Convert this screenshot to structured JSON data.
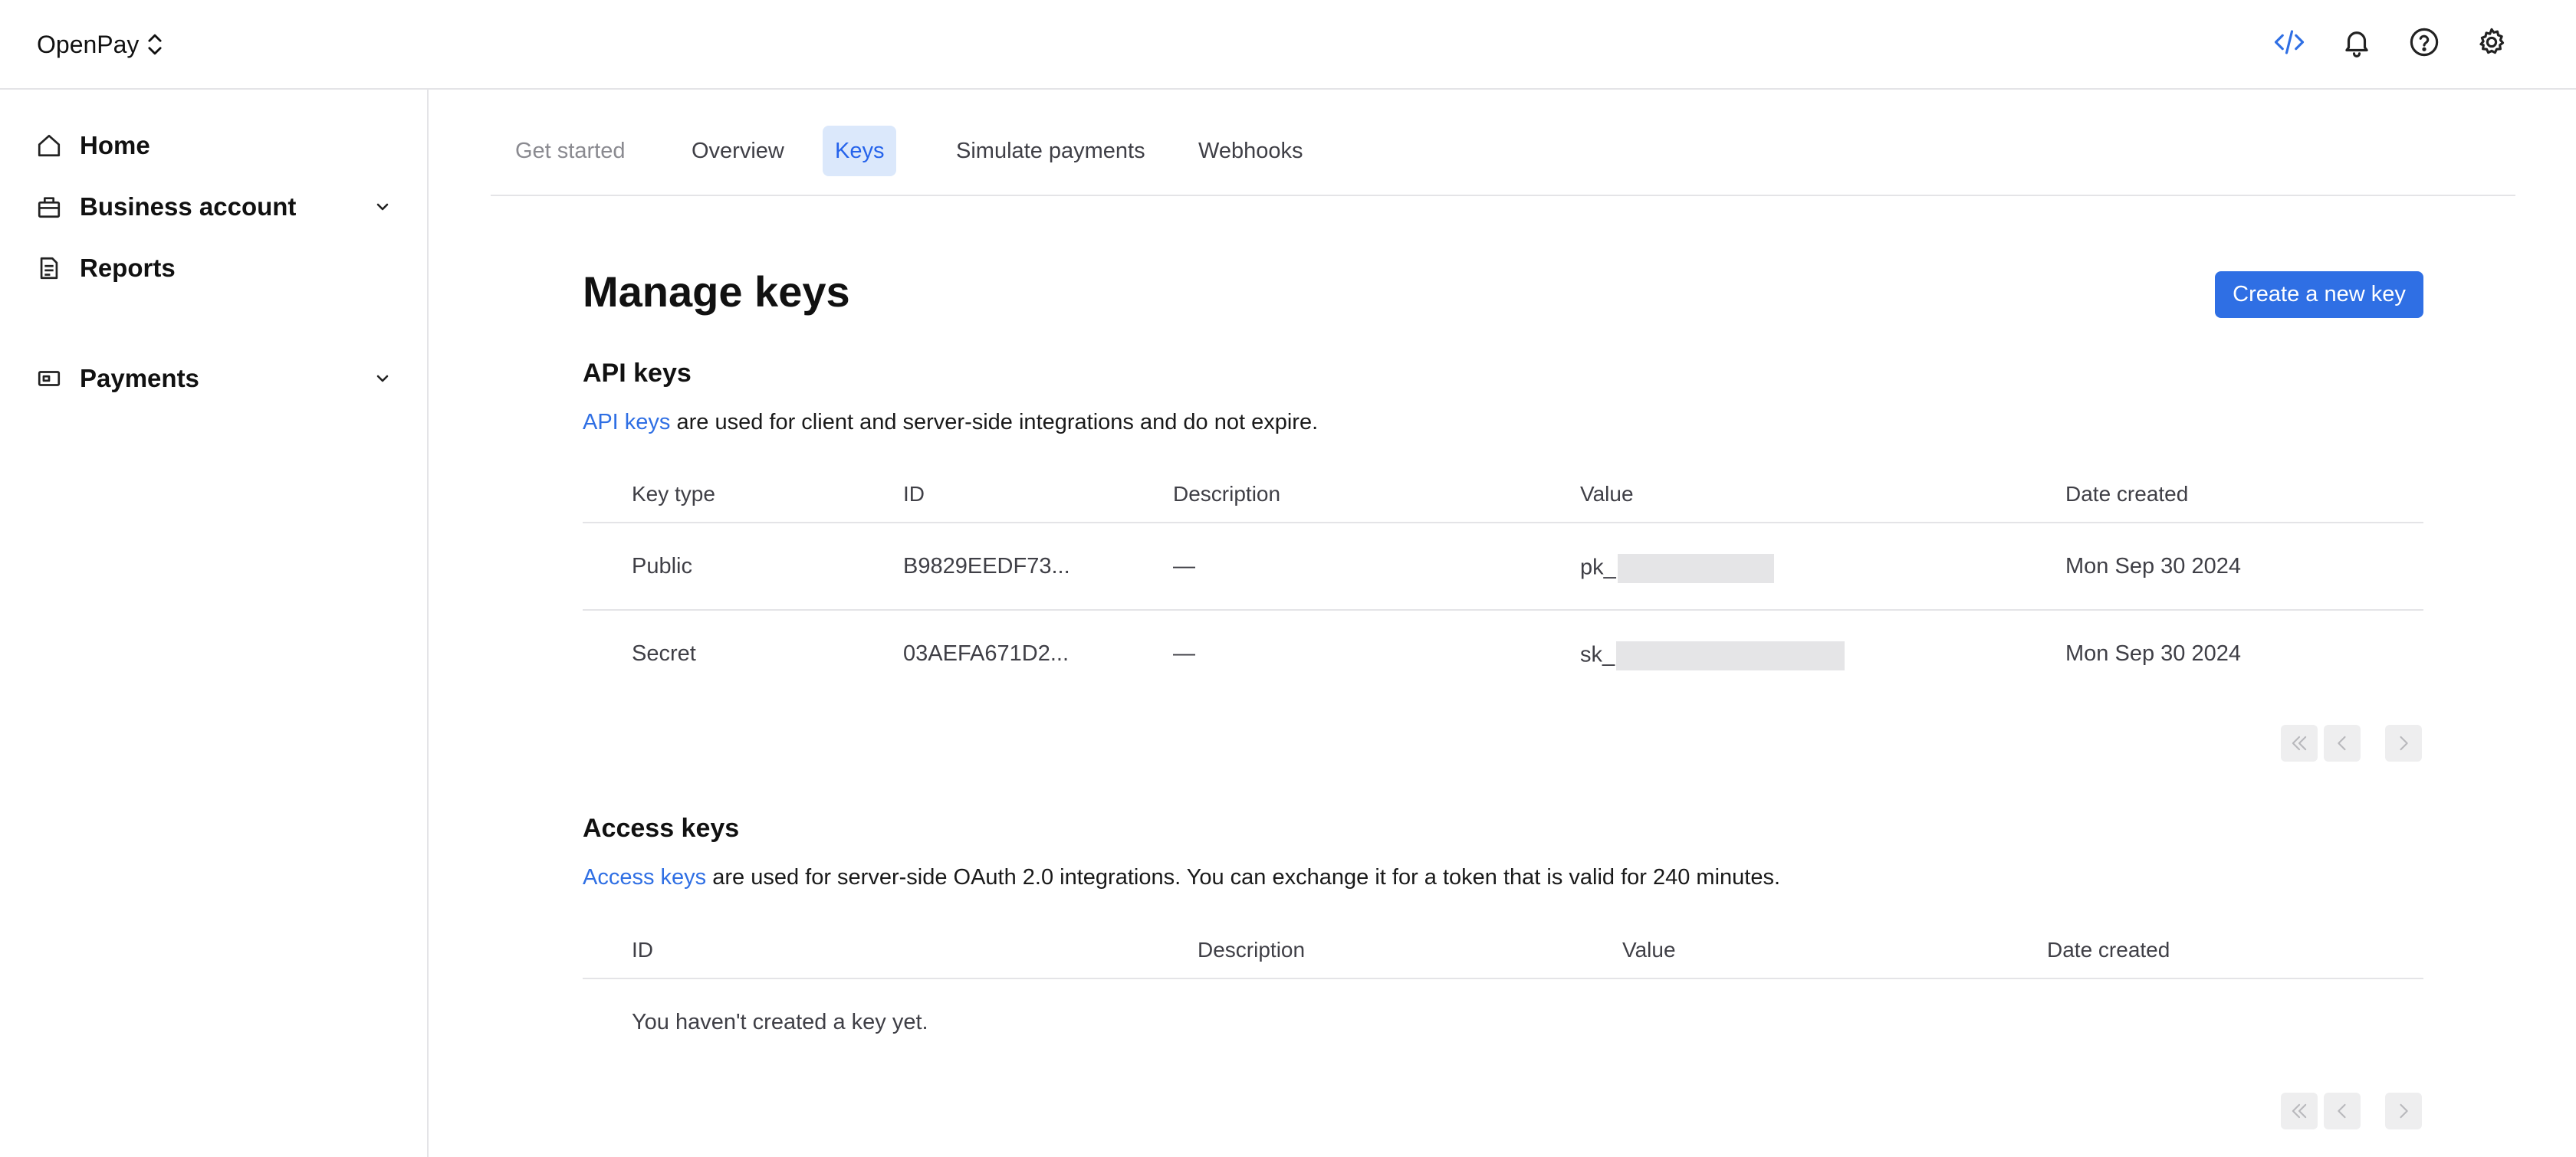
{
  "app": {
    "name": "OpenPay"
  },
  "topbar": {
    "icons": [
      "code-icon",
      "bell-icon",
      "help-icon",
      "settings-icon"
    ],
    "accent": "#2f6fe4"
  },
  "sidebar": {
    "items": [
      {
        "label": "Home",
        "icon": "home-icon"
      },
      {
        "label": "Business account",
        "icon": "briefcase-icon",
        "expandable": true
      },
      {
        "label": "Reports",
        "icon": "report-icon"
      },
      {
        "label": "Payments",
        "icon": "payments-icon",
        "expandable": true
      }
    ]
  },
  "tabs": [
    {
      "label": "Get started",
      "state": "muted"
    },
    {
      "label": "Overview",
      "state": "normal"
    },
    {
      "label": "Keys",
      "state": "active"
    },
    {
      "label": "Simulate payments",
      "state": "normal"
    },
    {
      "label": "Webhooks",
      "state": "normal"
    }
  ],
  "page": {
    "title": "Manage keys",
    "create_button": "Create a new key"
  },
  "api_keys": {
    "title": "API keys",
    "desc_link": "API keys",
    "desc_rest": " are used for client and server-side integrations and do not expire.",
    "columns": [
      "Key type",
      "ID",
      "Description",
      "Value",
      "Date created"
    ],
    "rows": [
      {
        "type": "Public",
        "id": "B9829EEDF73...",
        "description": "—",
        "value_prefix": "pk_",
        "date": "Mon Sep 30 2024"
      },
      {
        "type": "Secret",
        "id": "03AEFA671D2...",
        "description": "—",
        "value_prefix": "sk_",
        "date": "Mon Sep 30 2024"
      }
    ]
  },
  "access_keys": {
    "title": "Access keys",
    "desc_link": "Access keys",
    "desc_rest": " are used for server-side OAuth 2.0 integrations. You can exchange it for a token that is valid for 240 minutes.",
    "columns": [
      "ID",
      "Description",
      "Value",
      "Date created"
    ],
    "empty_text": "You haven't created a key yet."
  },
  "pagination": {
    "buttons": [
      "first-page-icon",
      "prev-page-icon",
      "next-page-icon"
    ]
  }
}
